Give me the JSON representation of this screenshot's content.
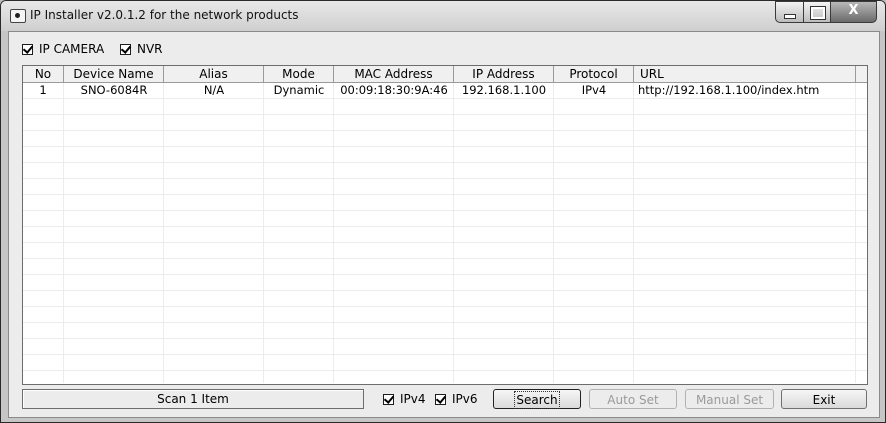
{
  "window": {
    "title": "IP Installer v2.0.1.2 for the network products",
    "controls": {
      "close_glyph": "X"
    }
  },
  "filters": {
    "ip_camera": {
      "label": "IP CAMERA",
      "checked": true
    },
    "nvr": {
      "label": "NVR",
      "checked": true
    }
  },
  "table": {
    "columns": [
      "No",
      "Device Name",
      "Alias",
      "Mode",
      "MAC Address",
      "IP Address",
      "Protocol",
      "URL"
    ],
    "rows": [
      {
        "no": "1",
        "device_name": "SNO-6084R",
        "alias": "N/A",
        "mode": "Dynamic",
        "mac": "00:09:18:30:9A:46",
        "ip": "192.168.1.100",
        "protocol": "IPv4",
        "url": "http://192.168.1.100/index.htm"
      }
    ]
  },
  "status": {
    "text": "Scan 1 Item"
  },
  "protocols": {
    "ipv4": {
      "label": "IPv4",
      "checked": true
    },
    "ipv6": {
      "label": "IPv6",
      "checked": true
    }
  },
  "buttons": {
    "search": "Search",
    "auto_set": "Auto Set",
    "manual_set": "Manual Set",
    "exit": "Exit"
  }
}
